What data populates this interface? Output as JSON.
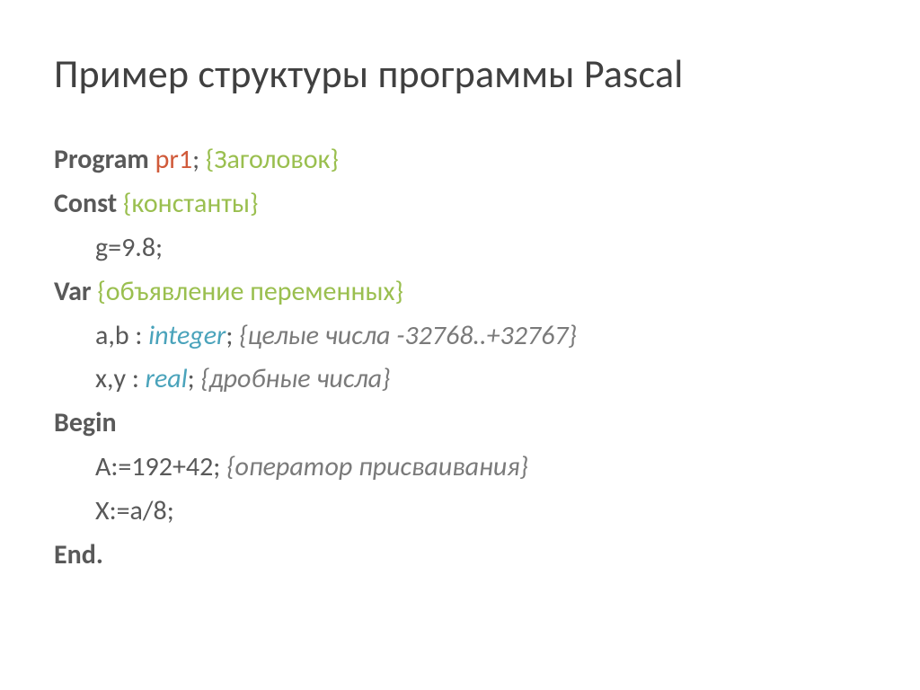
{
  "title": "Пример структуры программы Pascal",
  "kw": {
    "program": "Program",
    "const": "Const",
    "var": "Var",
    "begin": "Begin",
    "end": "End."
  },
  "l1": {
    "name": "pr1",
    "semi": ";",
    "cmt": "{Заголовок}"
  },
  "l2": {
    "cmt": "{константы}"
  },
  "l3": {
    "text": "g=9.8;"
  },
  "l4": {
    "cmt": "{объявление переменных}"
  },
  "l5": {
    "decl": "a,b :",
    "type": "integer",
    "semi": ";",
    "cmt": "{целые числа -32768..+32767}"
  },
  "l6": {
    "decl": "x,y :",
    "type": "real",
    "semi": ";",
    "cmt": "{дробные числа}"
  },
  "l8": {
    "text": "A:=192+42;",
    "cmt": "{оператор присваивания}"
  },
  "l9": {
    "text": "X:=a/8;"
  }
}
